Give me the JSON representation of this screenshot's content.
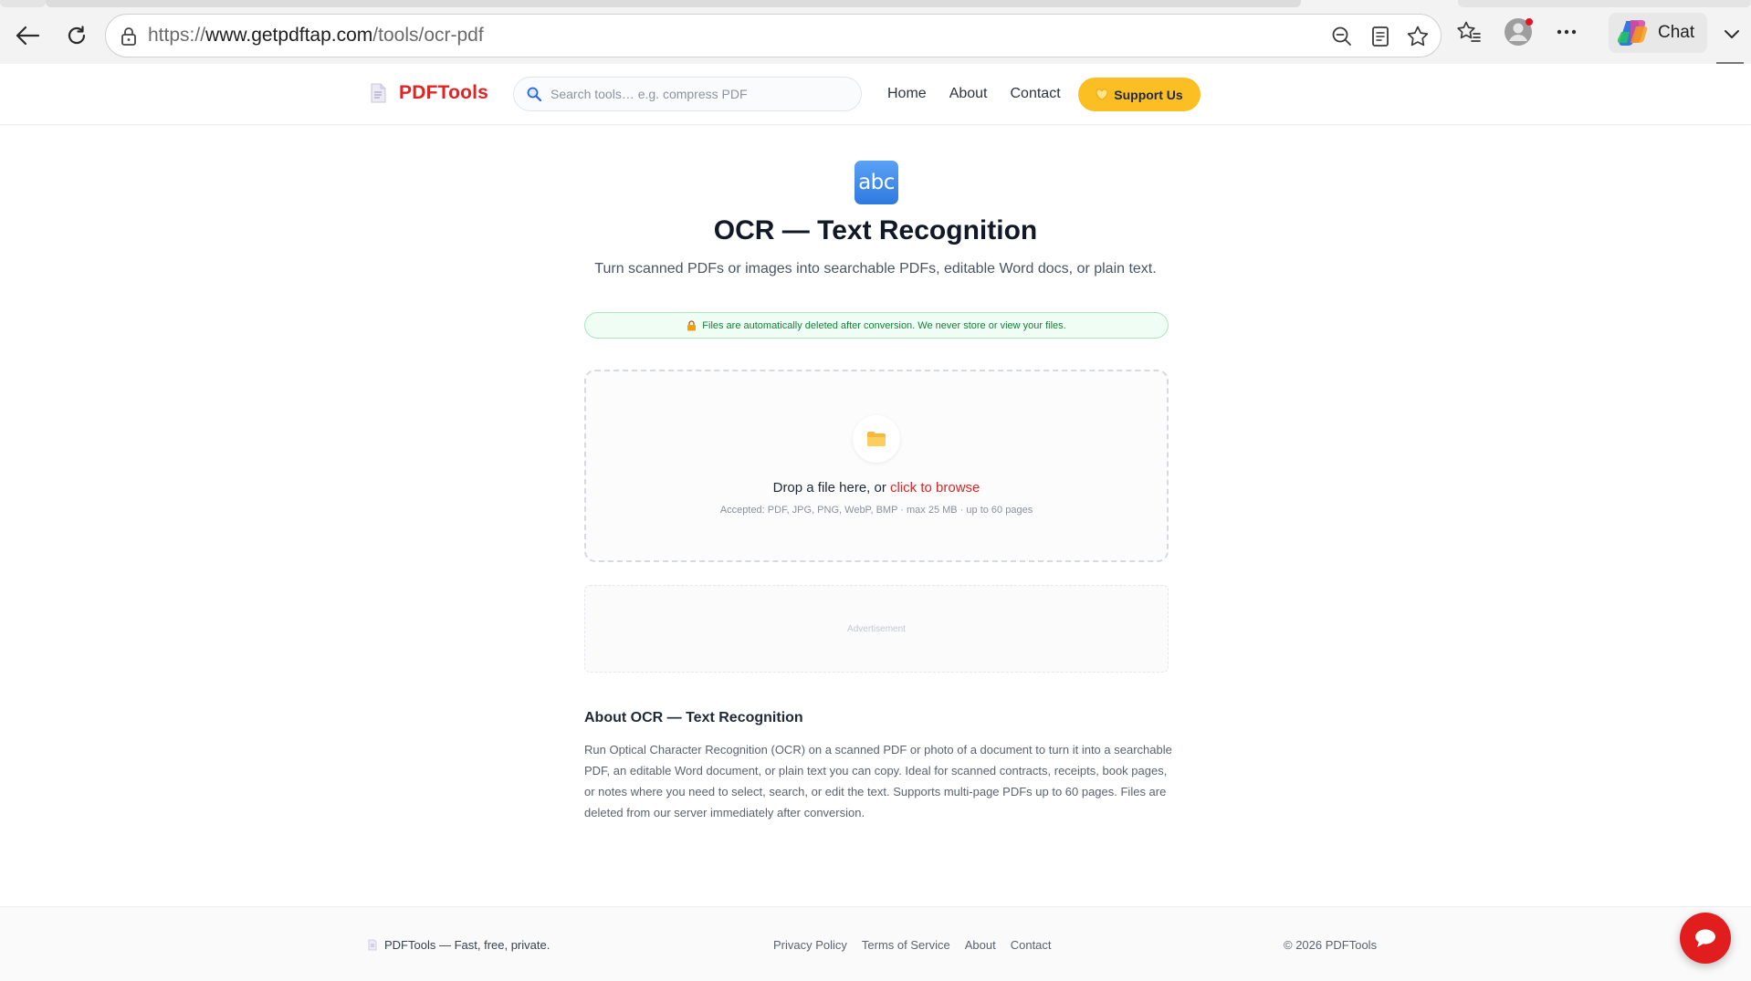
{
  "browser": {
    "url_prefix": "https://",
    "url_host": "www.getpdftap.com",
    "url_path": "/tools/ocr-pdf",
    "copilot_label": "Chat"
  },
  "header": {
    "logo_text": "PDFTools",
    "search_placeholder": "Search tools… e.g. compress PDF",
    "nav": [
      "Home",
      "About",
      "Contact"
    ],
    "support_label": "Support Us"
  },
  "tool": {
    "icon_text": "abc",
    "title": "OCR — Text Recognition",
    "subtitle": "Turn scanned PDFs or images into searchable PDFs, editable Word docs, or plain text."
  },
  "privacy_note": "Files are automatically deleted after conversion. We never store or view your files.",
  "dropzone": {
    "prompt": "Drop a file here, or ",
    "browse_label": "click to browse",
    "accepted": "Accepted: PDF, JPG, PNG, WebP, BMP · max 25 MB · up to 60 pages"
  },
  "ad_label": "Advertisement",
  "about": {
    "heading": "About OCR — Text Recognition",
    "body": "Run Optical Character Recognition (OCR) on a scanned PDF or photo of a document to turn it into a searchable PDF, an editable Word document, or plain text you can copy. Ideal for scanned contracts, receipts, book pages, or notes where you need to select, search, or edit the text. Supports multi-page PDFs up to 60 pages. Files are deleted from our server immediately after conversion."
  },
  "footer": {
    "brand": "PDFTools — Fast, free, private.",
    "links": [
      "Privacy Policy",
      "Terms of Service",
      "About",
      "Contact"
    ],
    "copyright": "© 2026 PDFTools"
  },
  "colors": {
    "brand_red": "#e02424",
    "support_yellow": "#fbbf24",
    "privacy_green": "#15803d",
    "chat_red": "#e11d1d"
  }
}
